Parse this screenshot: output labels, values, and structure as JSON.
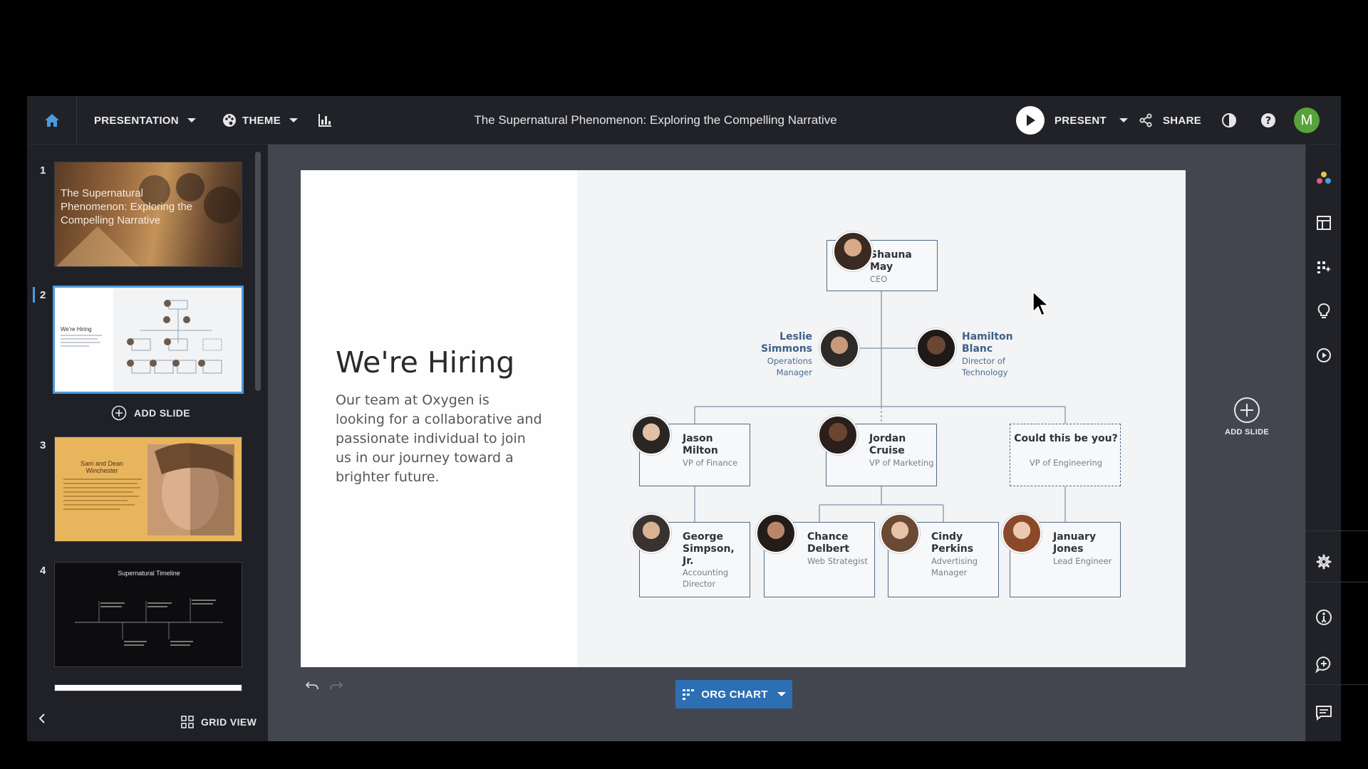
{
  "topbar": {
    "presentation_label": "PRESENTATION",
    "theme_label": "THEME",
    "doc_title": "The Supernatural Phenomenon: Exploring the Compelling Narrative",
    "present_label": "PRESENT",
    "share_label": "SHARE",
    "avatar_initial": "M"
  },
  "sidebar": {
    "slides": [
      {
        "number": "1",
        "title": "The Supernatural Phenomenon: Exploring the Compelling Narrative"
      },
      {
        "number": "2",
        "title": "We're Hiring"
      },
      {
        "number": "3",
        "title": "Sam and Dean Winchester"
      },
      {
        "number": "4",
        "title": "Supernatural Timeline"
      }
    ],
    "add_slide_label": "ADD SLIDE",
    "grid_view_label": "GRID VIEW"
  },
  "slide": {
    "heading": "We're Hiring",
    "body": "Our team at Oxygen is looking for a collaborative and passionate individual to join us in our journey toward a brighter future.",
    "org": {
      "ceo": {
        "name": "Shauna May",
        "role": "CEO"
      },
      "ops": {
        "name": "Leslie Simmons",
        "role": "Operations Manager"
      },
      "tech": {
        "name": "Hamilton Blanc",
        "role": "Director of Technology"
      },
      "finance": {
        "name": "Jason Milton",
        "role": "VP of Finance"
      },
      "marketing": {
        "name": "Jordan Cruise",
        "role": "VP of Marketing"
      },
      "engineering": {
        "name": "Could this be you?",
        "role": "VP of Engineering"
      },
      "accounting": {
        "name": "George Simpson, Jr.",
        "role": "Accounting Director"
      },
      "web": {
        "name": "Chance Delbert",
        "role": "Web Strategist"
      },
      "advertising": {
        "name": "Cindy Perkins",
        "role": "Advertising Manager"
      },
      "lead": {
        "name": "January Jones",
        "role": "Lead Engineer"
      }
    }
  },
  "canvas": {
    "add_slide_label": "ADD SLIDE",
    "org_chart_label": "ORG CHART"
  },
  "colors": {
    "accent": "#2d6fb4",
    "selection": "#4a9be0",
    "avatar_bg": "#57a33a",
    "chart_line": "#4f6b8a"
  }
}
